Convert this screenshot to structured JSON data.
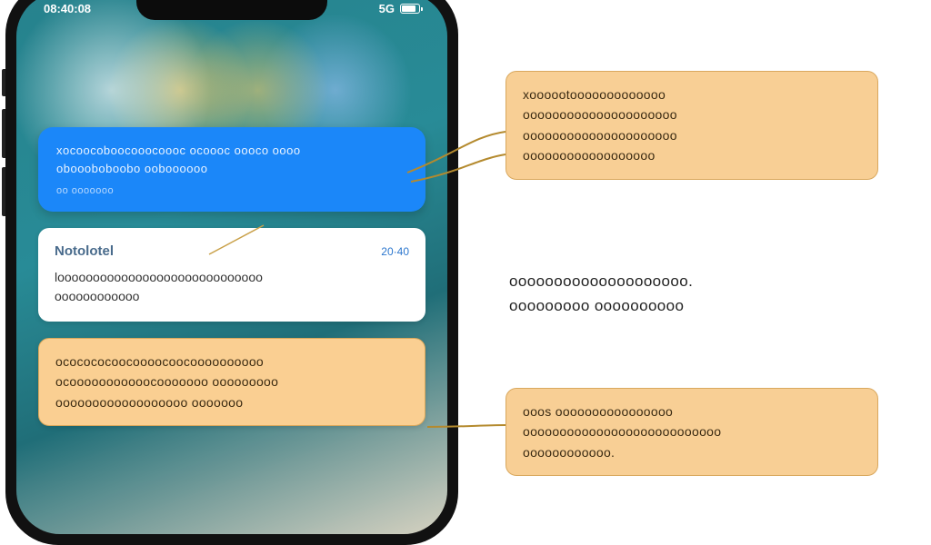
{
  "status": {
    "time": "08:40:08",
    "right": "5G"
  },
  "banner": {
    "line1": "xocoocoboocooocoooc ocoooc oooco oooo",
    "line2": "oboooboboobo ooboooooo",
    "footer": "oo ooooooo"
  },
  "card": {
    "title": "Notolotel",
    "meta": "20·40",
    "line1": "looooooooooooooooooooooooooooo",
    "line2": "oooooooooooo"
  },
  "orange_block": {
    "line1": "ococococoocoooocoocoooooooooo",
    "line2": "ocooooooooooocooooooo ooooooooo",
    "line3": "oooooooooooooooooo ooooooo"
  },
  "callout_top": {
    "line1": "xoooootooooooooooooo",
    "line2": "ooooooooooooooooooooo",
    "line3": "ooooooooooooooooooooo",
    "line4": "oooooooooooooooooo"
  },
  "caption": {
    "line1": "oooooooooooooooooooo.",
    "line2": "ooooooooo oooooooooo"
  },
  "callout_bottom": {
    "line1": "ooos oooooooooooooooo",
    "line2": "ooooooooooooooooooooooooooo",
    "line3": "oooooooooooo."
  }
}
